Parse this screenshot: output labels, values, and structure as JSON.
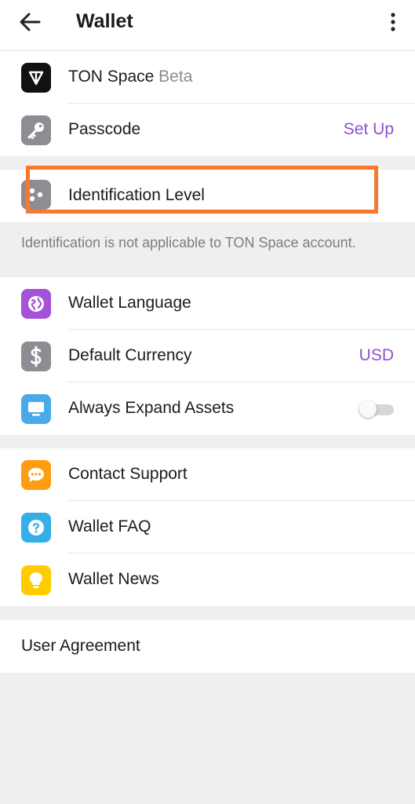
{
  "header": {
    "title": "Wallet"
  },
  "account": {
    "ton_space": {
      "label": "TON Space",
      "badge": "Beta",
      "icon": "ton-diamond-icon"
    },
    "passcode": {
      "label": "Passcode",
      "value": "Set Up",
      "icon": "key-icon"
    }
  },
  "identification": {
    "label": "Identification Level",
    "icon": "id-dots-icon",
    "note": "Identification is not applicable to TON Space account."
  },
  "settings": {
    "language": {
      "label": "Wallet Language",
      "icon": "globe-icon"
    },
    "currency": {
      "label": "Default Currency",
      "value": "USD",
      "icon": "dollar-icon"
    },
    "expand": {
      "label": "Always Expand Assets",
      "icon": "monitor-icon",
      "toggle_on": false
    }
  },
  "help": {
    "support": {
      "label": "Contact Support",
      "icon": "chat-bubble-icon"
    },
    "faq": {
      "label": "Wallet FAQ",
      "icon": "question-icon"
    },
    "news": {
      "label": "Wallet News",
      "icon": "lightbulb-icon"
    }
  },
  "legal": {
    "agreement": "User Agreement"
  },
  "colors": {
    "accent": "#8e4fd0",
    "highlight": "#f57a2e",
    "language_icon": "#a452d8",
    "gray_icon": "#8d8d93",
    "blue_icon": "#4aa9e9",
    "orange_icon": "#ff9c12",
    "yellow_icon": "#ffcc00"
  }
}
